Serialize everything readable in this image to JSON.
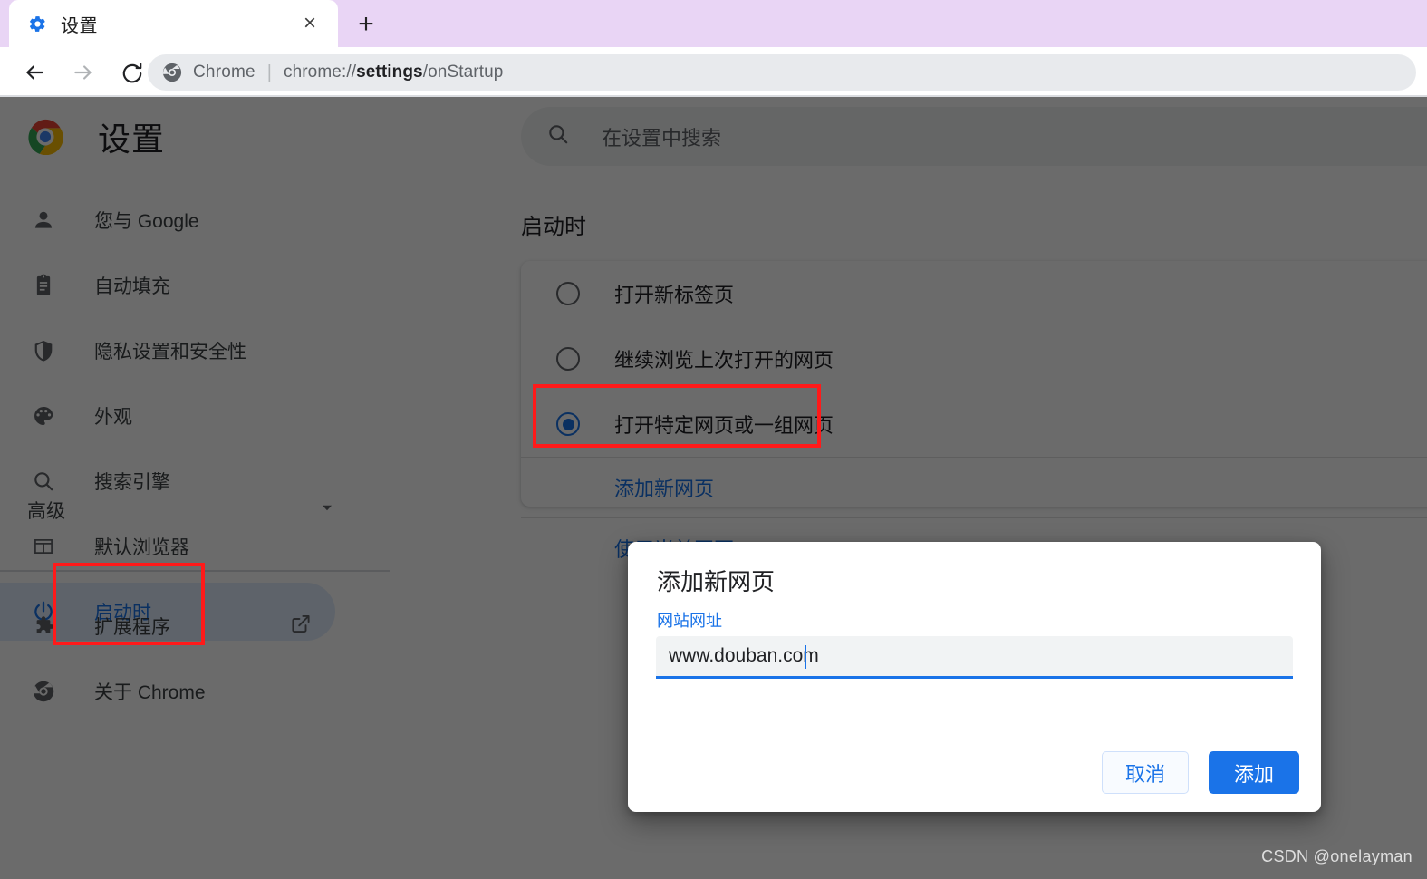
{
  "browser": {
    "tab": {
      "title": "设置",
      "favicon": "gear-icon",
      "close": "×"
    },
    "newtab_label": "+",
    "toolbar": {
      "back": "←",
      "forward": "→",
      "reload": "⟳",
      "chip": "Chrome",
      "separator": "|",
      "url_prefix": "chrome://",
      "url_bold": "settings",
      "url_suffix": "/onStartup"
    },
    "tabstrip_color": "#e9d5f5"
  },
  "sidebar": {
    "brand_title": "设置",
    "items": [
      {
        "label": "您与 Google",
        "icon": "person-icon"
      },
      {
        "label": "自动填充",
        "icon": "clipboard-icon"
      },
      {
        "label": "隐私设置和安全性",
        "icon": "shield-icon"
      },
      {
        "label": "外观",
        "icon": "palette-icon"
      },
      {
        "label": "搜索引擎",
        "icon": "search-icon"
      },
      {
        "label": "默认浏览器",
        "icon": "browser-window-icon"
      },
      {
        "label": "启动时",
        "icon": "power-icon"
      }
    ],
    "advanced": {
      "label": "高级",
      "caret": "▾"
    },
    "bottom_items": [
      {
        "label": "扩展程序",
        "icon": "puzzle-icon",
        "external": true
      },
      {
        "label": "关于 Chrome",
        "icon": "chrome-icon",
        "external": false
      }
    ]
  },
  "search": {
    "placeholder": "在设置中搜索",
    "icon": "search-icon"
  },
  "main": {
    "section_title": "启动时",
    "options": [
      {
        "label": "打开新标签页",
        "checked": false
      },
      {
        "label": "继续浏览上次打开的网页",
        "checked": false
      },
      {
        "label": "打开特定网页或一组网页",
        "checked": true
      }
    ],
    "add_page_link": "添加新网页",
    "use_current_link": "使用当前网页"
  },
  "dialog": {
    "title": "添加新网页",
    "field_label": "网站网址",
    "input_value": "www.douban.com",
    "input_placeholder": "",
    "cancel_label": "取消",
    "add_label": "添加"
  },
  "watermark": "CSDN @onelayman",
  "colors": {
    "accent": "#1a73e8",
    "annotation": "#ff1a1a",
    "tabstrip": "#e9d5f5",
    "omnibox": "#e8eaed"
  }
}
